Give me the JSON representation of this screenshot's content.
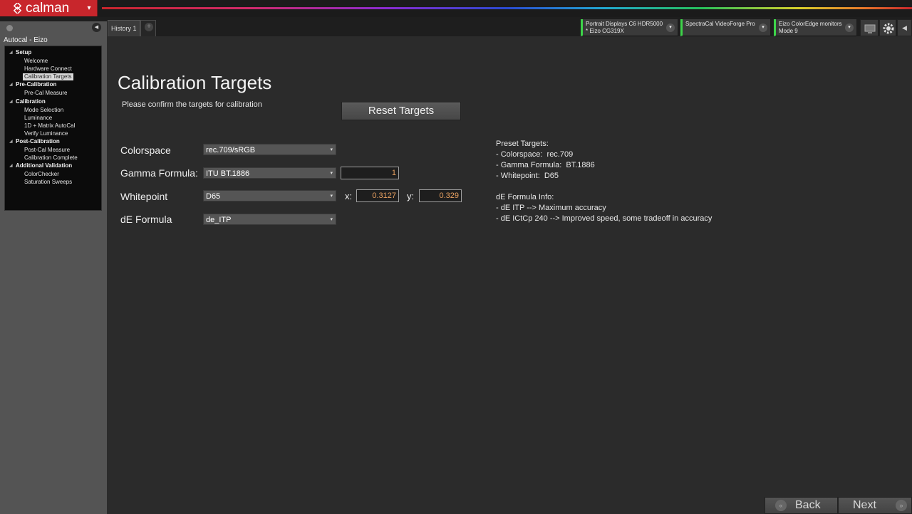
{
  "app": {
    "logo_text": "calman",
    "logo_icon": "calman-diamond-icon",
    "menu_caret": "▾"
  },
  "tabs": {
    "history_label": "History 1",
    "add_label": "+"
  },
  "devices": [
    {
      "line1": "Portrait Displays C6 HDR5000",
      "line2": "* Eizo CG319X",
      "status_color": "#3ed44a"
    },
    {
      "line1": "SpectraCal VideoForge Pro",
      "line2": "",
      "status_color": "#3ed44a"
    },
    {
      "line1": "Eizo ColorEdge monitors",
      "line2": "Mode 9",
      "status_color": "#3ed44a"
    }
  ],
  "toolbar": {
    "caret": "▾",
    "monitor_icon": "monitor-icon",
    "settings_icon": "gear-icon",
    "collapse_icon": "◀"
  },
  "sidebar": {
    "title": "Autocal - Eizo",
    "collapse": "◀",
    "groups": [
      {
        "label": "Setup",
        "items": [
          "Welcome",
          "Hardware Connect",
          "Calibration Targets"
        ]
      },
      {
        "label": "Pre-Calibration",
        "items": [
          "Pre-Cal Measure"
        ]
      },
      {
        "label": "Calibration",
        "items": [
          "Mode Selection",
          "Luminance",
          "1D + Matrix AutoCal",
          "Verify Luminance"
        ]
      },
      {
        "label": "Post-Calibration",
        "items": [
          "Post-Cal Measure",
          "Calibration Complete"
        ]
      },
      {
        "label": "Additional Validation",
        "items": [
          "ColorChecker",
          "Saturation Sweeps"
        ]
      }
    ],
    "selected_item": "Calibration Targets"
  },
  "main": {
    "title": "Calibration Targets",
    "subtitle": "Please confirm the targets for calibration",
    "reset_label": "Reset Targets",
    "fields": {
      "colorspace": {
        "label": "Colorspace",
        "value": "rec.709/sRGB"
      },
      "gamma": {
        "label": "Gamma Formula:",
        "value": "ITU BT.1886",
        "number": "1"
      },
      "whitepoint": {
        "label": "Whitepoint",
        "value": "D65",
        "x_label": "x:",
        "x": "0.3127",
        "y_label": "y:",
        "y": "0.329"
      },
      "de": {
        "label": "dE Formula",
        "value": "de_ITP"
      }
    },
    "dropdown_caret": "▾",
    "info_lines": [
      "Preset Targets:",
      "- Colorspace:  rec.709",
      "- Gamma Formula:  BT.1886",
      "- Whitepoint:  D65",
      "",
      "dE Formula Info:",
      "- dE ITP --> Maximum accuracy",
      "- dE ICtCp 240 --> Improved speed, some tradeoff in accuracy"
    ]
  },
  "nav": {
    "back_label": "Back",
    "next_label": "Next",
    "back_icon": "«",
    "next_icon": "»"
  },
  "colors": {
    "brand_red": "#c8262c",
    "status_green": "#3ed44a",
    "value_orange": "#e8a060"
  }
}
